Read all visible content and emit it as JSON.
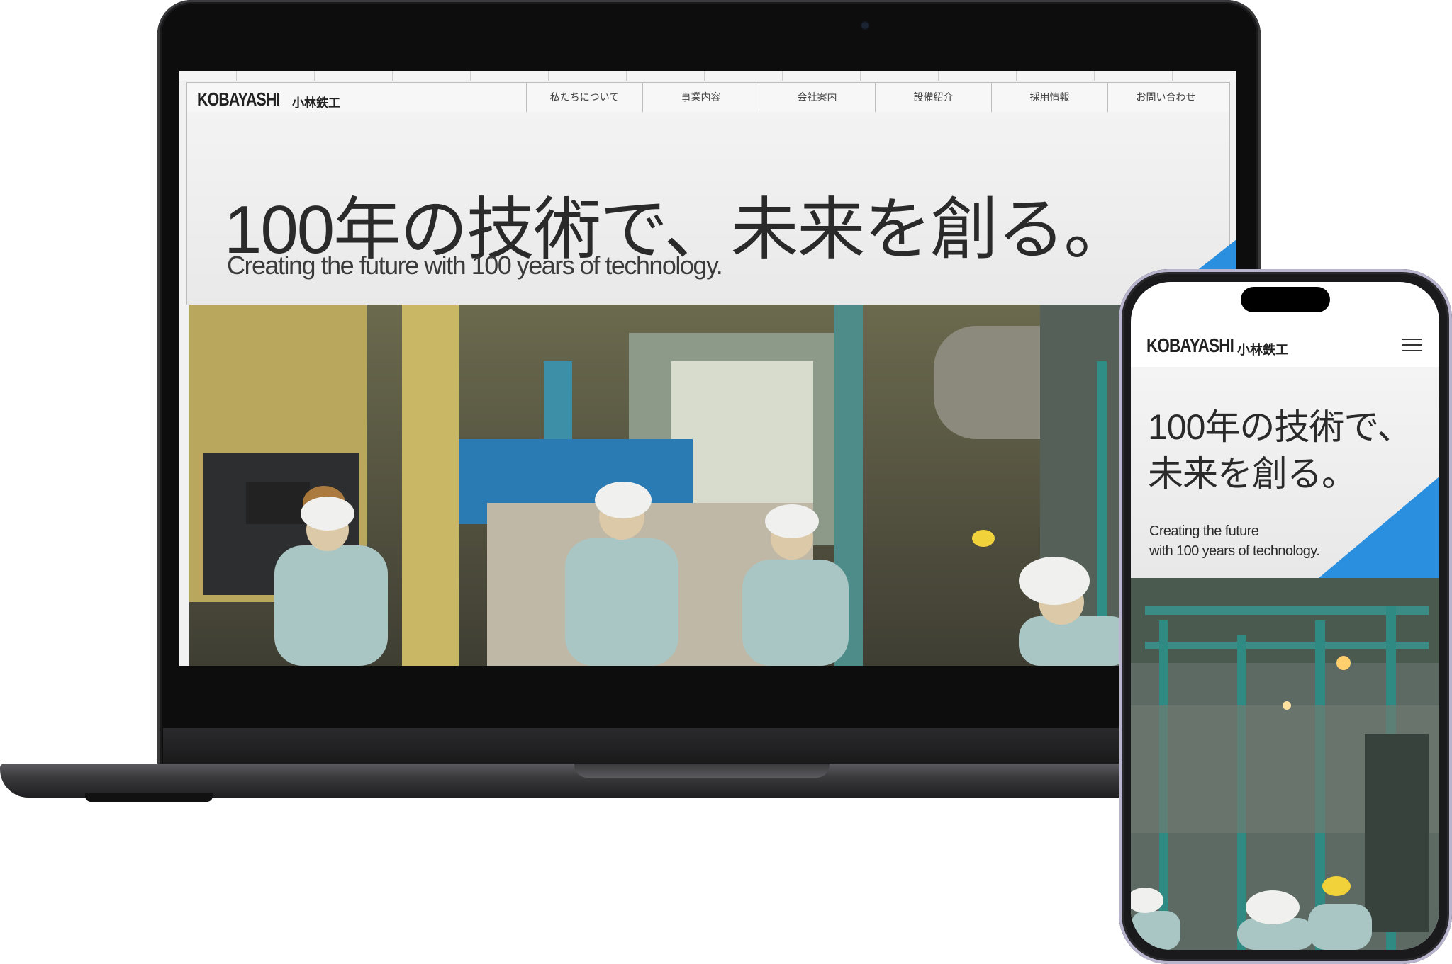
{
  "brand": {
    "logo_text": "KOBAYASHI",
    "logo_jp": "小林鉄工"
  },
  "desktop": {
    "nav": [
      "私たちについて",
      "事業内容",
      "会社案内",
      "設備紹介",
      "採用情報",
      "お問い合わせ"
    ],
    "hero_title": "100年の技術で、未来を創る。",
    "hero_subtitle": "Creating the future with 100 years of technology."
  },
  "mobile": {
    "hero_title_line1": "100年の技術で、",
    "hero_title_line2": "未来を創る。",
    "hero_subtitle_line1": "Creating the future",
    "hero_subtitle_line2": "with 100 years of technology."
  },
  "colors": {
    "accent": "#2b8fe0",
    "text": "#2a2a2a"
  },
  "icons": {
    "menu": "hamburger-menu-icon"
  }
}
